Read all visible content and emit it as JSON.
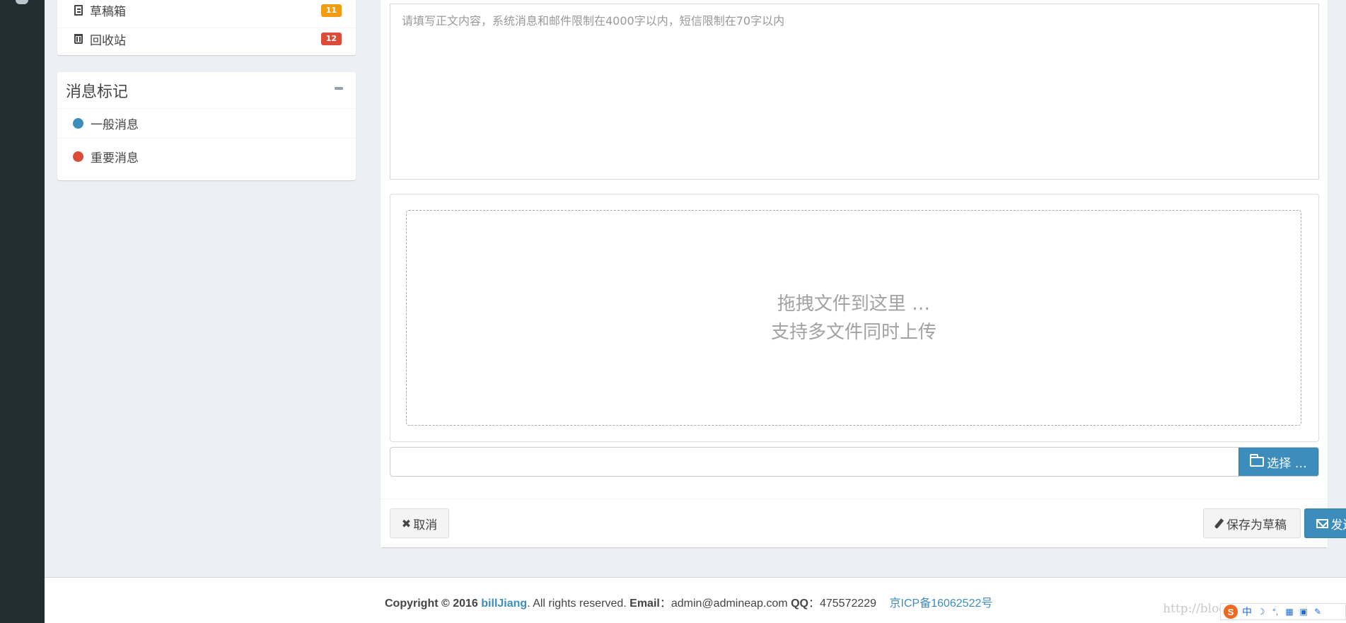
{
  "mailbox": {
    "items": [
      {
        "label": "草稿箱",
        "badge": "11",
        "badge_color": "#f39c12",
        "icon": "file-text-icon"
      },
      {
        "label": "回收站",
        "badge": "12",
        "badge_color": "#dd4b39",
        "icon": "trash-icon"
      }
    ]
  },
  "labels": {
    "title": "消息标记",
    "items": [
      {
        "label": "一般消息",
        "color": "#3c8dbc"
      },
      {
        "label": "重要消息",
        "color": "#dd4b39"
      }
    ]
  },
  "compose": {
    "body_placeholder": "请填写正文内容，系统消息和邮件限制在4000字以内，短信限制在70字以内",
    "drop_line1": "拖拽文件到这里 …",
    "drop_line2": "支持多文件同时上传",
    "browse_label": "选择 …",
    "cancel_label": "取消",
    "draft_label": "保存为草稿",
    "send_label": "发送"
  },
  "footer": {
    "copyright_prefix": "Copyright © 2016",
    "brand": "billJiang",
    "rights": ". All rights reserved.",
    "email_label": "Email",
    "email_sep": "：",
    "email": "admin@admineap.com",
    "qq_label": "QQ",
    "qq_sep": "：",
    "qq": "475572229",
    "icp": "京ICP备16062522号",
    "watermark": "http://blog.csdn.net/jrn"
  },
  "ime": {
    "logo": "S",
    "mode": "中"
  }
}
